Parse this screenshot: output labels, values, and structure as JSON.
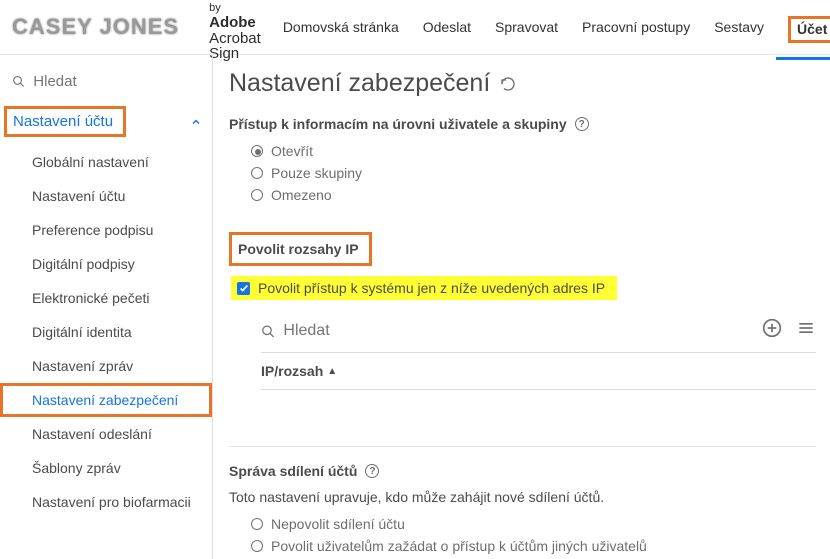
{
  "logo_text": "CASEY JONES",
  "powered_by": {
    "prefix": "Powered by",
    "brand": "Adobe",
    "product": "Acrobat Sign"
  },
  "topnav": {
    "items": [
      {
        "label": "Domovská stránka"
      },
      {
        "label": "Odeslat"
      },
      {
        "label": "Spravovat"
      },
      {
        "label": "Pracovní postupy"
      },
      {
        "label": "Sestavy"
      },
      {
        "label": "Účet",
        "active": true
      }
    ]
  },
  "sidebar": {
    "search_placeholder": "Hledat",
    "section_header": "Nastavení účtu",
    "items": [
      {
        "label": "Globální nastavení"
      },
      {
        "label": "Nastavení účtu"
      },
      {
        "label": "Preference podpisu"
      },
      {
        "label": "Digitální podpisy"
      },
      {
        "label": "Elektronické pečeti"
      },
      {
        "label": "Digitální identita"
      },
      {
        "label": "Nastavení zpráv"
      },
      {
        "label": "Nastavení zabezpečení",
        "selected": true
      },
      {
        "label": "Nastavení odeslání"
      },
      {
        "label": "Šablony zpráv"
      },
      {
        "label": "Nastavení pro biofarmacii"
      }
    ]
  },
  "page": {
    "title": "Nastavení zabezpečení",
    "access_section": {
      "label": "Přístup k informacím na úrovni uživatele a skupiny",
      "options": [
        {
          "label": "Otevřít",
          "checked": true
        },
        {
          "label": "Pouze skupiny",
          "checked": false
        },
        {
          "label": "Omezeno",
          "checked": false
        }
      ]
    },
    "ip_section": {
      "header": "Povolit rozsahy IP",
      "checkbox_label": "Povolit přístup k systému jen z níže uvedených adres IP",
      "search_placeholder": "Hledat",
      "column_header": "IP/rozsah"
    },
    "share_section": {
      "header": "Správa sdílení účtů",
      "description": "Toto nastavení upravuje, kdo může zahájit nové sdílení účtů.",
      "options": [
        {
          "label": "Nepovolit sdílení účtu",
          "checked": false
        },
        {
          "label": "Povolit uživatelům zažádat o přístup k účtům jiných uživatelů",
          "checked": false
        }
      ]
    }
  }
}
